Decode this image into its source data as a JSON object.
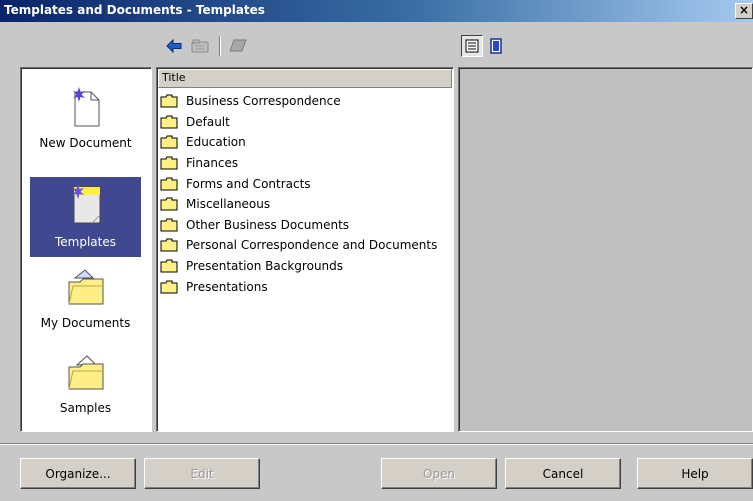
{
  "window": {
    "title": "Templates and Documents - Templates",
    "close_glyph": "×"
  },
  "toolbar": {
    "back_icon": "back-arrow-icon",
    "up_icon": "folder-up-icon",
    "print_icon": "print-icon",
    "details_view_icon": "details-view-icon",
    "document_view_icon": "document-preview-icon"
  },
  "nav": [
    {
      "label": "New Document",
      "icon": "new-document-icon",
      "selected": false
    },
    {
      "label": "Templates",
      "icon": "templates-icon",
      "selected": true
    },
    {
      "label": "My Documents",
      "icon": "my-documents-folder-icon",
      "selected": false
    },
    {
      "label": "Samples",
      "icon": "samples-folder-icon",
      "selected": false
    }
  ],
  "list": {
    "column_title": "Title",
    "items": [
      "Business Correspondence",
      "Default",
      "Education",
      "Finances",
      "Forms and Contracts",
      "Miscellaneous",
      "Other Business Documents",
      "Personal Correspondence and Documents",
      "Presentation Backgrounds",
      "Presentations"
    ]
  },
  "buttons": {
    "organize": "Organize...",
    "edit": "Edit",
    "open": "Open",
    "cancel": "Cancel",
    "help": "Help"
  },
  "colors": {
    "selection": "#404890",
    "title_bar": "#0a246a",
    "folder_yellow": "#ffef84"
  }
}
